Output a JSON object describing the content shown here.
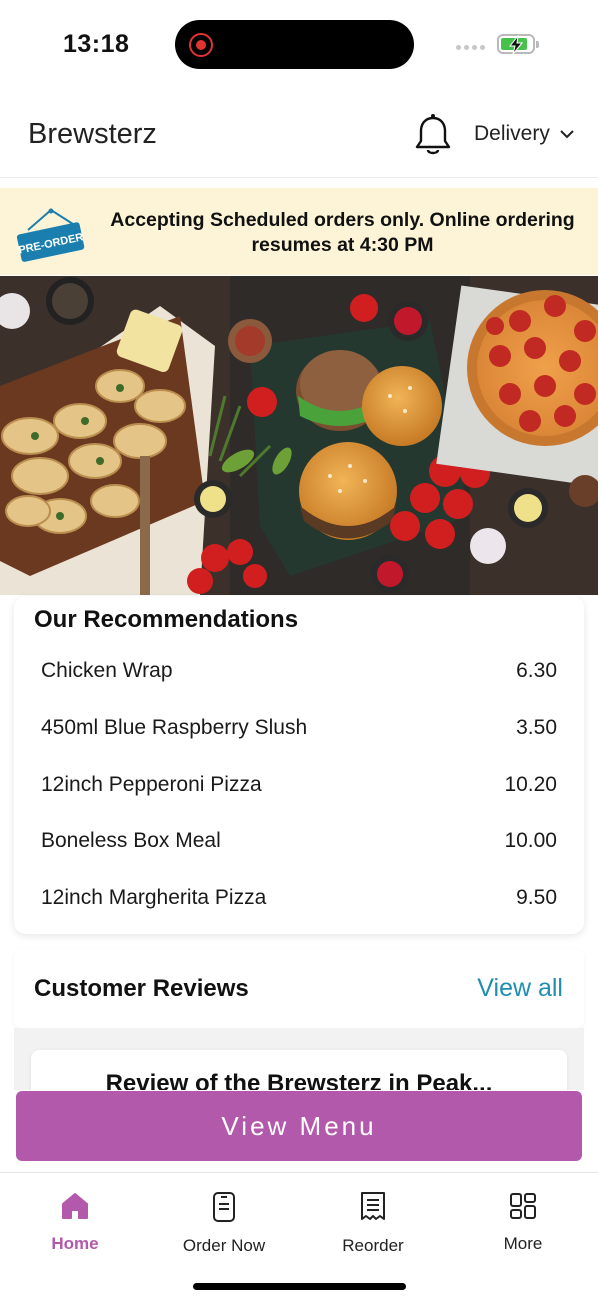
{
  "status_bar": {
    "time": "13:18"
  },
  "header": {
    "brand": "Brewsterz",
    "delivery_label": "Delivery"
  },
  "notice": {
    "tag": "PRE-ORDER",
    "message": "Accepting Scheduled orders only. Online ordering resumes at 4:30 PM"
  },
  "recommendations": {
    "title": "Our Recommendations",
    "items": [
      {
        "name": "Chicken Wrap",
        "price": "6.30"
      },
      {
        "name": "450ml Blue Raspberry Slush",
        "price": "3.50"
      },
      {
        "name": "12inch Pepperoni Pizza",
        "price": "10.20"
      },
      {
        "name": "Boneless Box Meal",
        "price": "10.00"
      },
      {
        "name": "12inch Margherita Pizza",
        "price": "9.50"
      }
    ]
  },
  "reviews": {
    "title": "Customer Reviews",
    "view_all": "View all",
    "first_review_heading": "Review of the Brewsterz in Peak..."
  },
  "view_menu_button": "View Menu",
  "bottom_nav": [
    {
      "label": "Home",
      "icon": "home-icon",
      "active": true
    },
    {
      "label": "Order Now",
      "icon": "phone-order-icon",
      "active": false
    },
    {
      "label": "Reorder",
      "icon": "receipt-icon",
      "active": false
    },
    {
      "label": "More",
      "icon": "grid-icon",
      "active": false
    }
  ],
  "colors": {
    "accent": "#b359ab",
    "link": "#1f8fb0",
    "notice_bg": "#fdf4d7",
    "preorder_tag": "#1a7fae"
  }
}
